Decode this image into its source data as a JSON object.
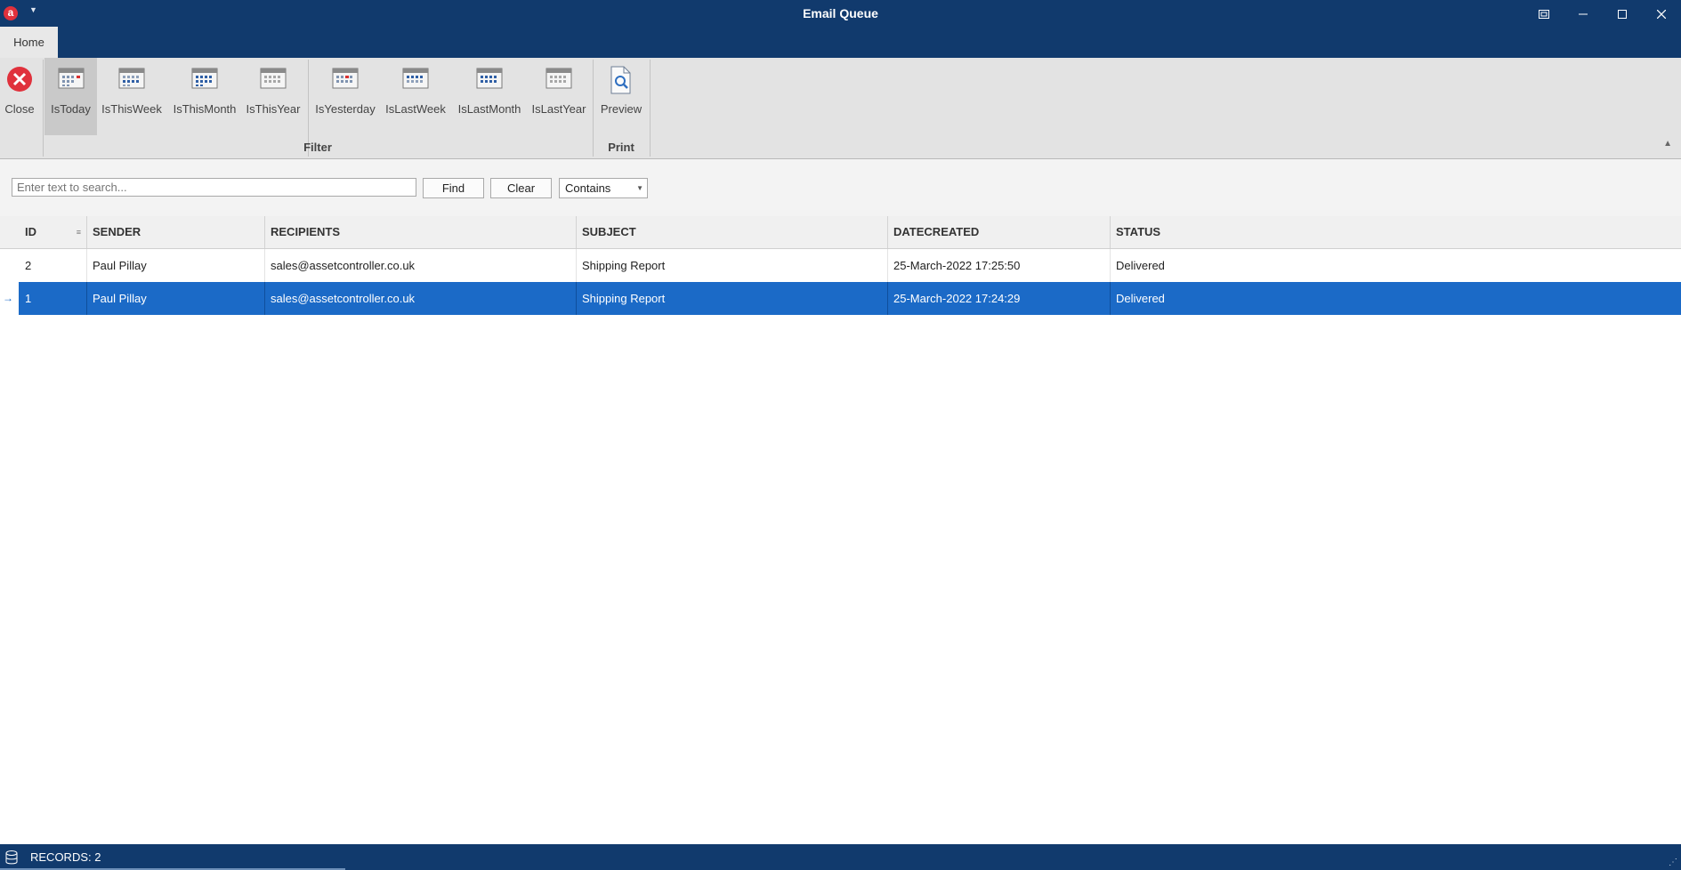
{
  "window": {
    "title": "Email Queue",
    "app_icon_letter": "a"
  },
  "ribbon": {
    "tabs": [
      {
        "label": "Home"
      }
    ],
    "buttons": {
      "close": "Close",
      "is_today": "IsToday",
      "is_this_week": "IsThisWeek",
      "is_this_month": "IsThisMonth",
      "is_this_year": "IsThisYear",
      "is_yesterday": "IsYesterday",
      "is_last_week": "IsLastWeek",
      "is_last_month": "IsLastMonth",
      "is_last_year": "IsLastYear",
      "preview": "Preview"
    },
    "groups": {
      "filter": "Filter",
      "print": "Print"
    }
  },
  "search": {
    "placeholder": "Enter text to search...",
    "find_label": "Find",
    "clear_label": "Clear",
    "mode": "Contains"
  },
  "grid": {
    "columns": [
      "ID",
      "SENDER",
      "RECIPIENTS",
      "SUBJECT",
      "DATECREATED",
      "STATUS"
    ],
    "rows": [
      {
        "id": "2",
        "sender": "Paul Pillay",
        "recipients": "sales@assetcontroller.co.uk",
        "subject": "Shipping Report",
        "datecreated": "25-March-2022 17:25:50",
        "status": "Delivered"
      },
      {
        "id": "1",
        "sender": "Paul Pillay",
        "recipients": "sales@assetcontroller.co.uk",
        "subject": "Shipping Report",
        "datecreated": "25-March-2022 17:24:29",
        "status": "Delivered"
      }
    ],
    "selected_row": 1
  },
  "status": {
    "records": "RECORDS: 2"
  },
  "colors": {
    "titlebar": "#113a6d",
    "selection": "#1b6ac7",
    "close_icon": "#e0313c"
  }
}
